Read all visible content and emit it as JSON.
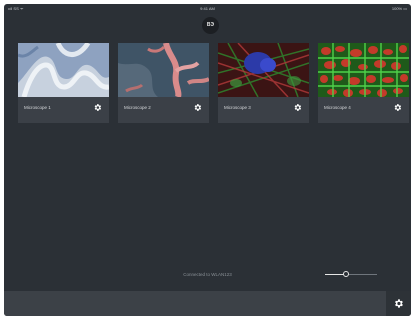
{
  "status_bar": {
    "left": "•ıll SS ᯤ",
    "time": "9:41 AM",
    "right": "100% ▭"
  },
  "brand": {
    "logo_text": "ВЭ"
  },
  "microscopes": [
    {
      "label": "Microscope 1"
    },
    {
      "label": "Microscope 2"
    },
    {
      "label": "Microscope 3"
    },
    {
      "label": "Microscope 4"
    }
  ],
  "connection": {
    "text": "Connected to WLAN123"
  },
  "zoom_slider": {
    "value": 0.4
  },
  "icons": {
    "card_settings": "gear-icon",
    "bottom_settings": "gear-icon"
  },
  "colors": {
    "background": "#2b3036",
    "card": "#3b4047",
    "bottom_bar": "#3c4147"
  }
}
